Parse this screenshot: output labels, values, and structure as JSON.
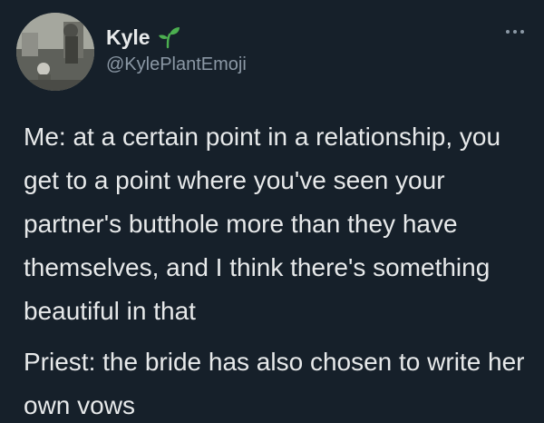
{
  "tweet": {
    "author": {
      "display_name": "Kyle",
      "handle": "@KylePlantEmoji",
      "badge_icon": "seedling-icon",
      "avatar": "profile-photo"
    },
    "more_icon": "more-horizontal-icon",
    "paragraphs": [
      "Me: at a certain point in a relationship, you get to a point where you've seen your partner's butthole more than they have themselves, and I think there's something beautiful in that",
      "Priest: the bride has also chosen to write her own vows"
    ]
  },
  "colors": {
    "background": "#16202a",
    "text": "#e7e9ea",
    "secondary_text": "#8b98a5",
    "seedling": "#4caf50"
  }
}
